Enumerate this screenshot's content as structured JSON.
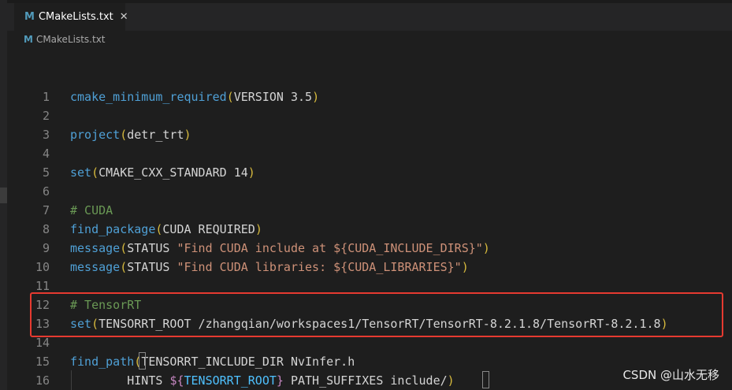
{
  "tab": {
    "icon": "M",
    "label": "CMakeLists.txt",
    "close": "✕"
  },
  "breadcrumb": {
    "icon": "M",
    "label": "CMakeLists.txt"
  },
  "lines": [
    {
      "n": "1",
      "parts": [
        [
          "fn",
          "cmake_minimum_required"
        ],
        [
          "paren",
          "("
        ],
        [
          "text",
          "VERSION 3.5"
        ],
        [
          "paren",
          ")"
        ]
      ]
    },
    {
      "n": "2",
      "parts": []
    },
    {
      "n": "3",
      "parts": [
        [
          "fn",
          "project"
        ],
        [
          "paren",
          "("
        ],
        [
          "text",
          "detr_trt"
        ],
        [
          "paren",
          ")"
        ]
      ]
    },
    {
      "n": "4",
      "parts": []
    },
    {
      "n": "5",
      "parts": [
        [
          "fn",
          "set"
        ],
        [
          "paren",
          "("
        ],
        [
          "text",
          "CMAKE_CXX_STANDARD 14"
        ],
        [
          "paren",
          ")"
        ]
      ]
    },
    {
      "n": "6",
      "parts": []
    },
    {
      "n": "7",
      "parts": [
        [
          "comment",
          "# CUDA"
        ]
      ]
    },
    {
      "n": "8",
      "parts": [
        [
          "fn",
          "find_package"
        ],
        [
          "paren",
          "("
        ],
        [
          "text",
          "CUDA REQUIRED"
        ],
        [
          "paren",
          ")"
        ]
      ]
    },
    {
      "n": "9",
      "parts": [
        [
          "fn",
          "message"
        ],
        [
          "paren",
          "("
        ],
        [
          "text",
          "STATUS "
        ],
        [
          "str",
          "\"Find CUDA include at ${CUDA_INCLUDE_DIRS}\""
        ],
        [
          "paren",
          ")"
        ]
      ]
    },
    {
      "n": "10",
      "parts": [
        [
          "fn",
          "message"
        ],
        [
          "paren",
          "("
        ],
        [
          "text",
          "STATUS "
        ],
        [
          "str",
          "\"Find CUDA libraries: ${CUDA_LIBRARIES}\""
        ],
        [
          "paren",
          ")"
        ]
      ]
    },
    {
      "n": "11",
      "parts": []
    },
    {
      "n": "12",
      "parts": [
        [
          "comment",
          "# TensorRT"
        ]
      ]
    },
    {
      "n": "13",
      "parts": [
        [
          "fn",
          "set"
        ],
        [
          "paren",
          "("
        ],
        [
          "text",
          "TENSORRT_ROOT /zhangqian/workspaces1/TensorRT/TensorRT-8.2.1.8/TensorRT-8.2.1.8"
        ],
        [
          "paren",
          ")"
        ]
      ]
    },
    {
      "n": "14",
      "parts": []
    },
    {
      "n": "15",
      "parts": [
        [
          "fn",
          "find_path"
        ],
        [
          "paren",
          "("
        ],
        [
          "text",
          "TENSORRT_INCLUDE_DIR NvInfer.h"
        ]
      ]
    },
    {
      "n": "16",
      "parts": [
        [
          "text",
          "        HINTS "
        ],
        [
          "paren2",
          "${"
        ],
        [
          "var",
          "TENSORRT_ROOT"
        ],
        [
          "paren2",
          "}"
        ],
        [
          "text",
          " PATH_SUFFIXES include/"
        ],
        [
          "paren",
          ")"
        ]
      ]
    }
  ],
  "watermark": "CSDN @山水无移",
  "colors": {
    "background": "#1e1e1e",
    "function": "#4fa0d6",
    "paren": "#d7ba3d",
    "string": "#ce9178",
    "comment": "#6a9955",
    "variable": "#4fc1ff",
    "highlight_border": "#e63a30"
  }
}
